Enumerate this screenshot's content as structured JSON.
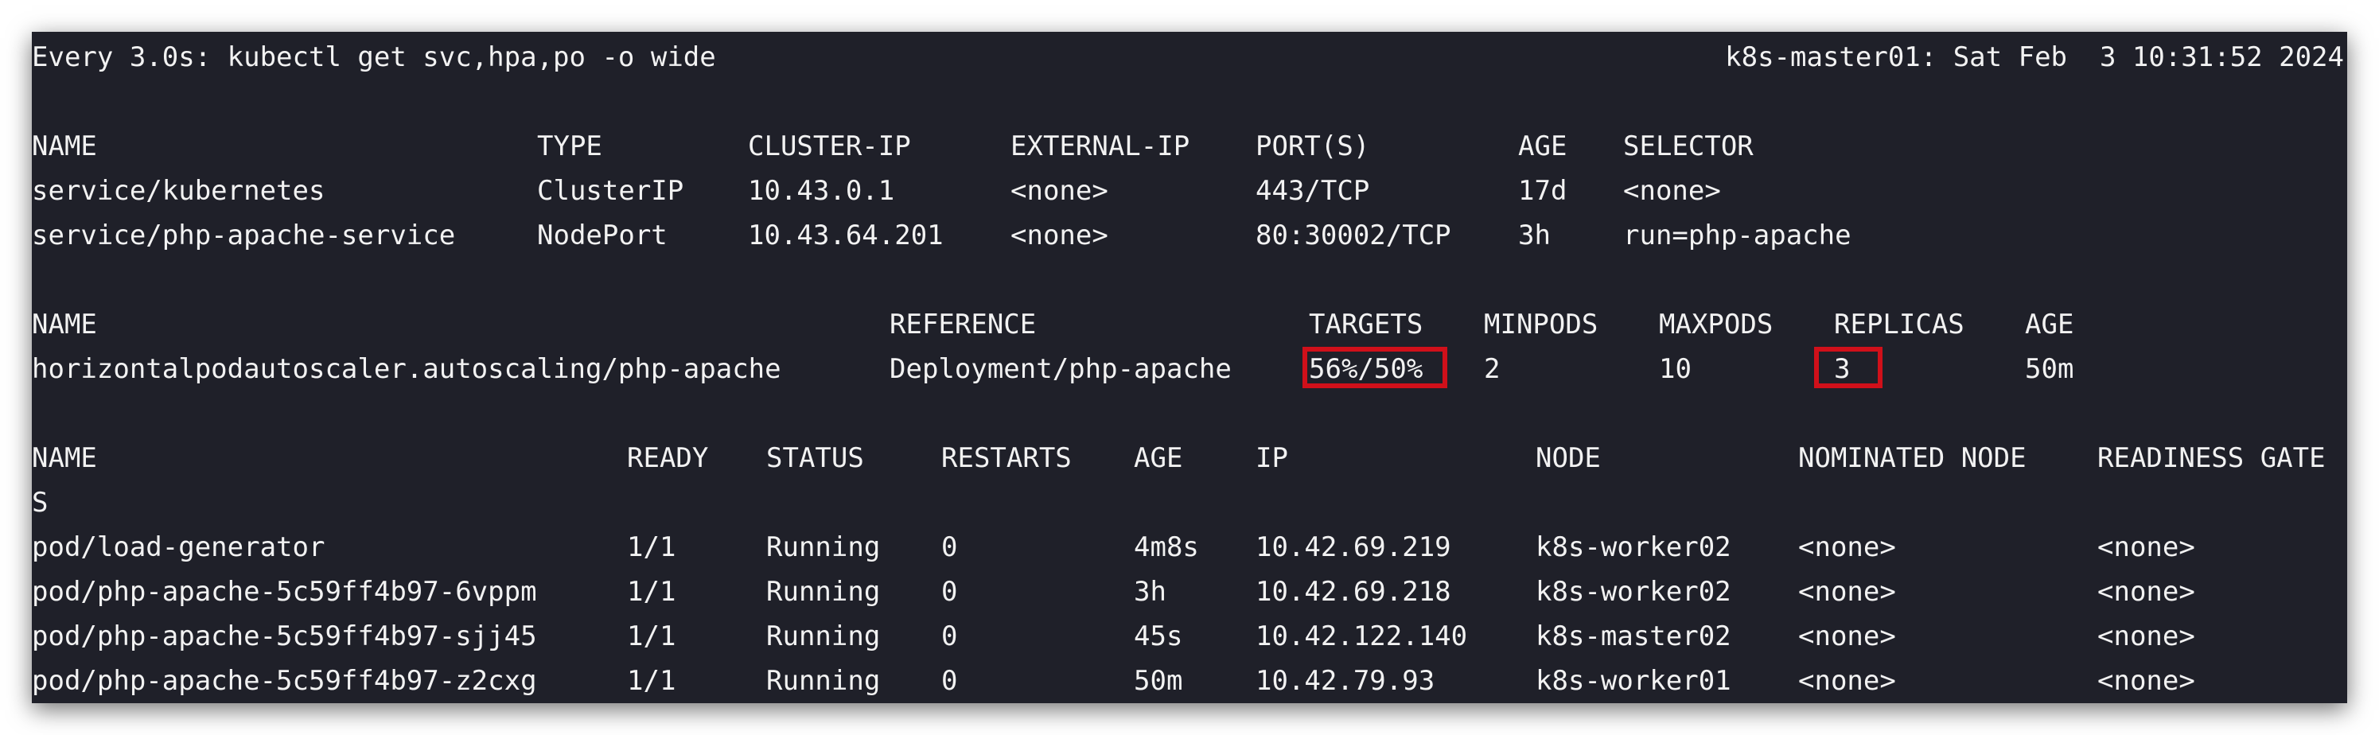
{
  "watch": {
    "header_left": "Every 3.0s: kubectl get svc,hpa,po -o wide",
    "header_right": "k8s-master01: Sat Feb  3 10:31:52 2024"
  },
  "services": {
    "headers": [
      "NAME",
      "TYPE",
      "CLUSTER-IP",
      "EXTERNAL-IP",
      "PORT(S)",
      "AGE",
      "SELECTOR"
    ],
    "rows": [
      [
        "service/kubernetes",
        "ClusterIP",
        "10.43.0.1",
        "<none>",
        "443/TCP",
        "17d",
        "<none>"
      ],
      [
        "service/php-apache-service",
        "NodePort",
        "10.43.64.201",
        "<none>",
        "80:30002/TCP",
        "3h",
        "run=php-apache"
      ]
    ]
  },
  "hpa": {
    "headers": [
      "NAME",
      "REFERENCE",
      "TARGETS",
      "MINPODS",
      "MAXPODS",
      "REPLICAS",
      "AGE"
    ],
    "rows": [
      [
        "horizontalpodautoscaler.autoscaling/php-apache",
        "Deployment/php-apache",
        "56%/50%",
        "2",
        "10",
        "3",
        "50m"
      ]
    ]
  },
  "pods": {
    "headers": [
      "NAME",
      "READY",
      "STATUS",
      "RESTARTS",
      "AGE",
      "IP",
      "NODE",
      "NOMINATED NODE",
      "READINESS GATE"
    ],
    "header_wrap": "S",
    "rows": [
      [
        "pod/load-generator",
        "1/1",
        "Running",
        "0",
        "4m8s",
        "10.42.69.219",
        "k8s-worker02",
        "<none>",
        "<none>"
      ],
      [
        "pod/php-apache-5c59ff4b97-6vppm",
        "1/1",
        "Running",
        "0",
        "3h",
        "10.42.69.218",
        "k8s-worker02",
        "<none>",
        "<none>"
      ],
      [
        "pod/php-apache-5c59ff4b97-sjj45",
        "1/1",
        "Running",
        "0",
        "45s",
        "10.42.122.140",
        "k8s-master02",
        "<none>",
        "<none>"
      ],
      [
        "pod/php-apache-5c59ff4b97-z2cxg",
        "1/1",
        "Running",
        "0",
        "50m",
        "10.42.79.93",
        "k8s-worker01",
        "<none>",
        "<none>"
      ]
    ]
  },
  "colors": {
    "background": "#1f2029",
    "text": "#f2f2f2",
    "highlight": "#d0101a"
  }
}
